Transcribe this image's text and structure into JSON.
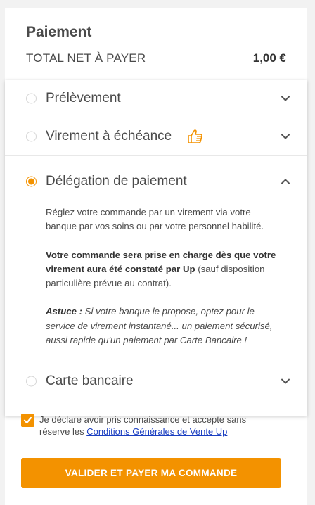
{
  "header": {
    "title": "Paiement",
    "total_label": "TOTAL NET À PAYER",
    "total_value": "1,00 €"
  },
  "payment_methods": [
    {
      "label": "Prélèvement",
      "selected": false,
      "expanded": false,
      "icon": "chevron-down-icon"
    },
    {
      "label": "Virement à échéance",
      "selected": false,
      "expanded": false,
      "icon": "chevron-down-icon",
      "badge_icon": "thumbs-up-icon"
    },
    {
      "label": "Délégation de paiement",
      "selected": true,
      "expanded": true,
      "icon": "chevron-up-icon",
      "details": {
        "p1": "Réglez votre commande par un virement via votre banque par vos soins ou par votre personnel habilité.",
        "p2_bold": "Votre commande sera prise en charge dès que votre virement aura été constaté par Up",
        "p2_rest": " (sauf disposition particulière prévue au contrat).",
        "p3_bold": "Astuce :",
        "p3_rest": " Si votre banque le propose, optez pour le service de virement instantané... un paiement sécurisé, aussi rapide qu'un paiement par Carte Bancaire !"
      }
    },
    {
      "label": "Carte bancaire",
      "selected": false,
      "expanded": false,
      "icon": "chevron-down-icon"
    }
  ],
  "consent": {
    "checked": true,
    "text": "Je déclare avoir pris connaissance et accepte sans réserve les ",
    "link": "Conditions Générales de Vente Up"
  },
  "cta": {
    "label": "VALIDER ET PAYER MA COMMANDE"
  },
  "colors": {
    "accent": "#f39200",
    "link": "#1a3ec1",
    "text": "#4a4a4a"
  }
}
